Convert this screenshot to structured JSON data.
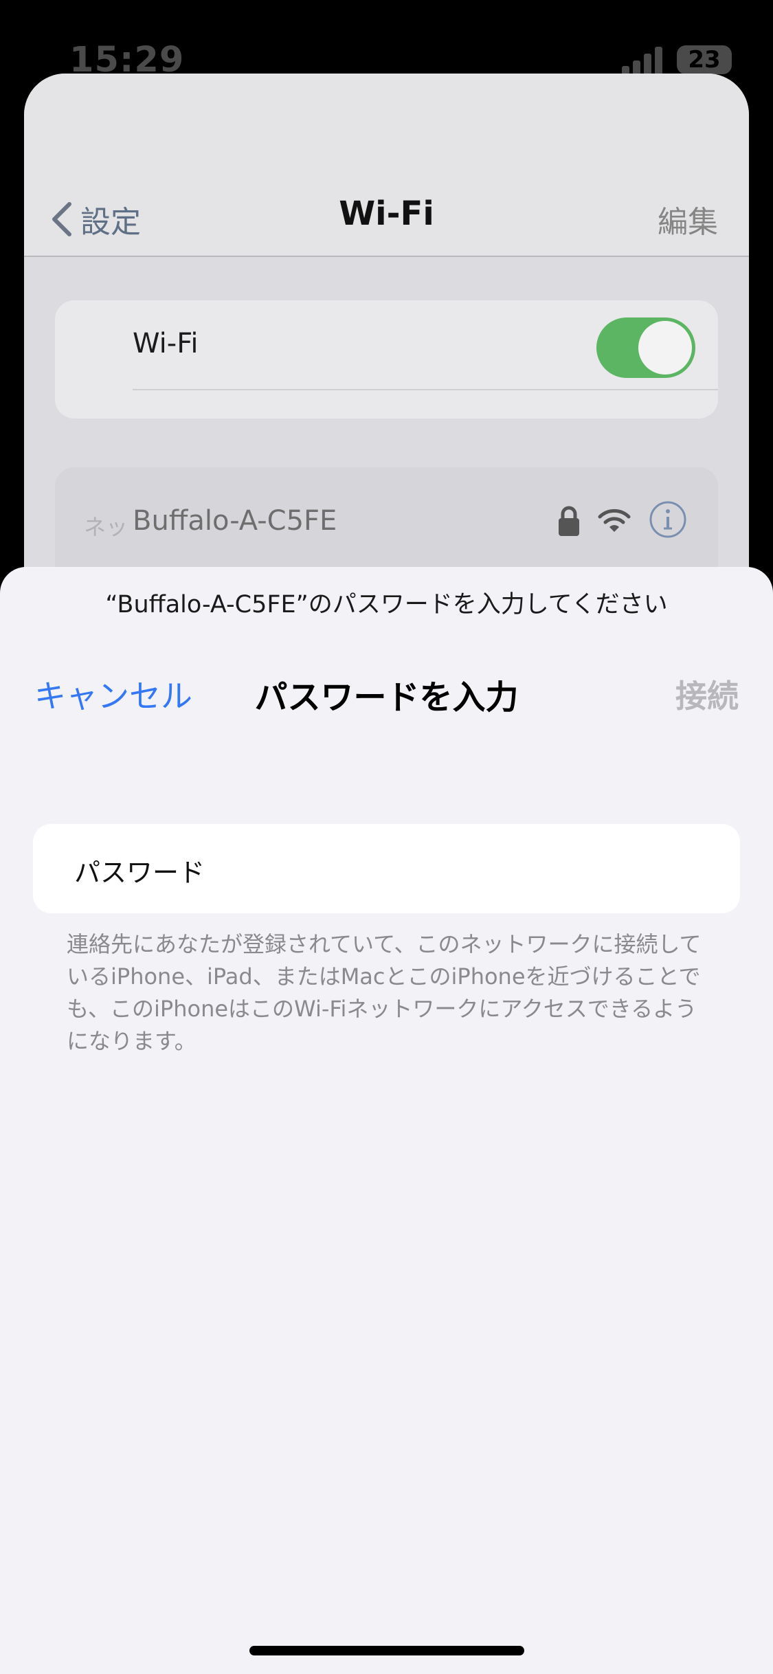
{
  "status_bar": {
    "time": "15:29",
    "battery": "23"
  },
  "settings": {
    "back_label": "設定",
    "title": "Wi-Fi",
    "edit_label": "編集",
    "wifi_toggle": {
      "label": "Wi-Fi",
      "on": true
    },
    "network": {
      "prefix_label": "ネッ",
      "name": "Buffalo-A-C5FE",
      "secured": true
    }
  },
  "password_sheet": {
    "prompt": "“Buffalo-A-C5FE”のパスワードを入力してください",
    "cancel_label": "キャンセル",
    "title": "パスワードを入力",
    "join_label": "接続",
    "field": {
      "label": "パスワード",
      "value": ""
    },
    "hint": "連絡先にあなたが登録されていて、このネットワークに接続しているiPhone、iPad、またはMacとこのiPhoneを近づけることでも、このiPhoneはこのWi-Fiネットワークにアクセスできるようになります。"
  },
  "colors": {
    "accent": "#3478f6",
    "toggle_on": "#5cb563",
    "sheet_background": "#f2f2f7"
  },
  "icons": [
    "cellular-signal-icon",
    "battery-icon",
    "chevron-left-icon",
    "lock-icon",
    "wifi-signal-icon",
    "info-icon"
  ]
}
